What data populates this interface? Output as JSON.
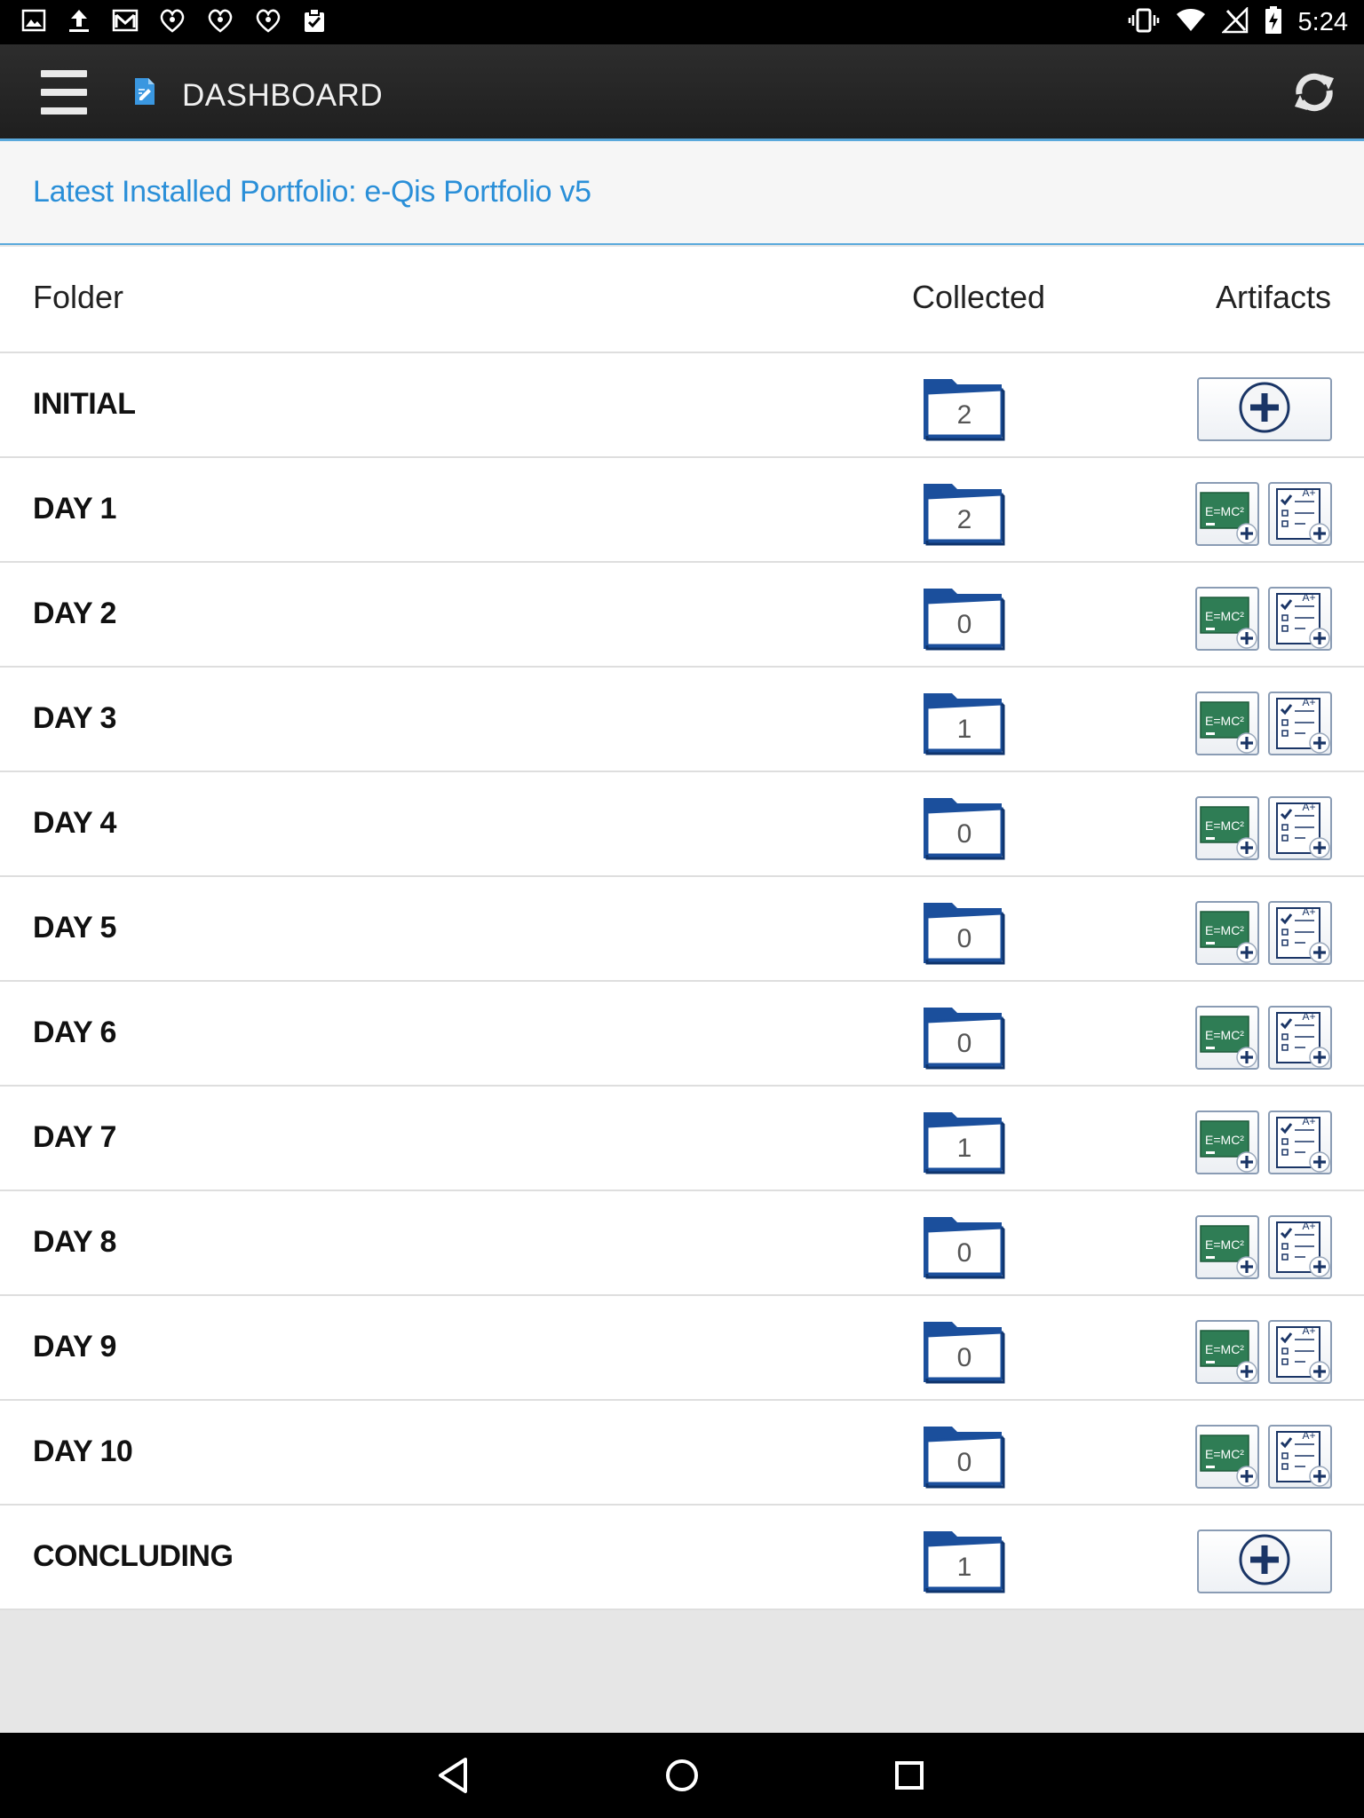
{
  "status_bar": {
    "time": "5:24",
    "left_icons": [
      "image-icon",
      "upload-icon",
      "gmail-icon",
      "iheartradio-icon",
      "iheartradio-icon",
      "iheartradio-icon",
      "clipboard-check-icon"
    ],
    "right_icons": [
      "vibrate-icon",
      "wifi-icon",
      "no-signal-icon",
      "battery-charging-icon"
    ]
  },
  "app_bar": {
    "title": "DASHBOARD",
    "menu_icon": "hamburger-menu-icon",
    "title_icon": "document-icon",
    "action_icon": "refresh-icon"
  },
  "banner": {
    "text": "Latest Installed Portfolio: e-Qis Portfolio v5"
  },
  "table": {
    "headers": {
      "folder": "Folder",
      "collected": "Collected",
      "artifacts": "Artifacts"
    },
    "rows": [
      {
        "name": "INITIAL",
        "collected": "2",
        "artifact_type": "add"
      },
      {
        "name": "DAY 1",
        "collected": "2",
        "artifact_type": "pair"
      },
      {
        "name": "DAY 2",
        "collected": "0",
        "artifact_type": "pair"
      },
      {
        "name": "DAY 3",
        "collected": "1",
        "artifact_type": "pair"
      },
      {
        "name": "DAY 4",
        "collected": "0",
        "artifact_type": "pair"
      },
      {
        "name": "DAY 5",
        "collected": "0",
        "artifact_type": "pair"
      },
      {
        "name": "DAY 6",
        "collected": "0",
        "artifact_type": "pair"
      },
      {
        "name": "DAY 7",
        "collected": "1",
        "artifact_type": "pair"
      },
      {
        "name": "DAY 8",
        "collected": "0",
        "artifact_type": "pair"
      },
      {
        "name": "DAY 9",
        "collected": "0",
        "artifact_type": "pair"
      },
      {
        "name": "DAY 10",
        "collected": "0",
        "artifact_type": "pair"
      },
      {
        "name": "CONCLUDING",
        "collected": "1",
        "artifact_type": "add"
      }
    ],
    "artifact_icons": {
      "add": "plus-circle-icon",
      "formula": "emc2-chalkboard-icon",
      "checklist": "checklist-grade-icon"
    },
    "formula_text": "E=MC²",
    "checklist_grade": "A+"
  },
  "colors": {
    "accent": "#2a8fd8",
    "folder_blue": "#1b4f9c",
    "chalkboard_green": "#2f7d55",
    "navy": "#1a3566"
  },
  "nav_bar": {
    "icons": [
      "back-icon",
      "home-icon",
      "recents-icon"
    ]
  }
}
